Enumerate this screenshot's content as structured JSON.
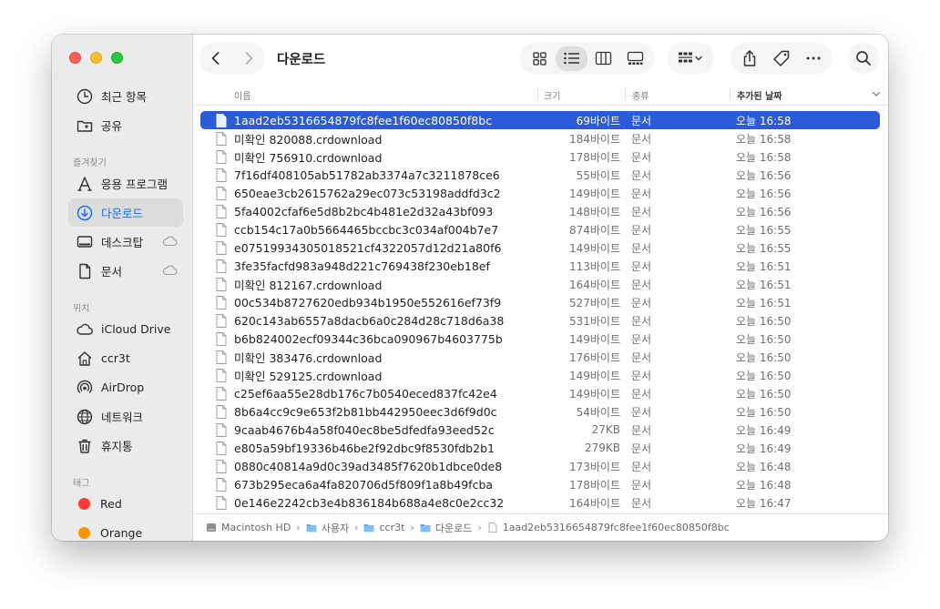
{
  "window": {
    "title": "다운로드"
  },
  "sidebar": {
    "recent": "최근 항목",
    "shared": "공유",
    "favorites_header": "즐겨찾기",
    "favorites": [
      {
        "label": "응용 프로그램",
        "icon": "applications-icon"
      },
      {
        "label": "다운로드",
        "icon": "downloads-icon",
        "active": true
      },
      {
        "label": "데스크탑",
        "icon": "desktop-icon",
        "cloud": true
      },
      {
        "label": "문서",
        "icon": "document-icon",
        "cloud": true
      }
    ],
    "locations_header": "위치",
    "locations": [
      {
        "label": "iCloud Drive",
        "icon": "cloud-icon"
      },
      {
        "label": "ccr3t",
        "icon": "home-icon"
      },
      {
        "label": "AirDrop",
        "icon": "airdrop-icon"
      },
      {
        "label": "네트워크",
        "icon": "globe-icon"
      },
      {
        "label": "휴지통",
        "icon": "trash-icon"
      }
    ],
    "tags_header": "태그",
    "tags": [
      {
        "label": "Red",
        "color": "#fe3b30"
      },
      {
        "label": "Orange",
        "color": "#fd9500"
      }
    ]
  },
  "columns": {
    "name": "이름",
    "size": "크기",
    "kind": "종류",
    "date": "추가된 날짜"
  },
  "files": [
    {
      "name": "1aad2eb5316654879fc8fee1f60ec80850f8bc",
      "size": "69바이트",
      "kind": "문서",
      "date": "오늘 16:58",
      "selected": true
    },
    {
      "name": "미확인 820088.crdownload",
      "size": "184바이트",
      "kind": "문서",
      "date": "오늘 16:58"
    },
    {
      "name": "미확인 756910.crdownload",
      "size": "178바이트",
      "kind": "문서",
      "date": "오늘 16:58"
    },
    {
      "name": "7f16df408105ab51782ab3374a7c3211878ce6",
      "size": "55바이트",
      "kind": "문서",
      "date": "오늘 16:56"
    },
    {
      "name": "650eae3cb2615762a29ec073c53198addfd3c2",
      "size": "149바이트",
      "kind": "문서",
      "date": "오늘 16:56"
    },
    {
      "name": "5fa4002cfaf6e5d8b2bc4b481e2d32a43bf093",
      "size": "148바이트",
      "kind": "문서",
      "date": "오늘 16:56"
    },
    {
      "name": "ccb154c17a0b5664465bccbc3c034af004b7e7",
      "size": "874바이트",
      "kind": "문서",
      "date": "오늘 16:55"
    },
    {
      "name": "e07519934305018521cf4322057d12d21a80f6",
      "size": "149바이트",
      "kind": "문서",
      "date": "오늘 16:55"
    },
    {
      "name": "3fe35facfd983a948d221c769438f230eb18ef",
      "size": "113바이트",
      "kind": "문서",
      "date": "오늘 16:51"
    },
    {
      "name": "미확인 812167.crdownload",
      "size": "164바이트",
      "kind": "문서",
      "date": "오늘 16:51"
    },
    {
      "name": "00c534b8727620edb934b1950e552616ef73f9",
      "size": "527바이트",
      "kind": "문서",
      "date": "오늘 16:51"
    },
    {
      "name": "620c143ab6557a8dacb6a0c284d28c718d6a38",
      "size": "531바이트",
      "kind": "문서",
      "date": "오늘 16:50"
    },
    {
      "name": "b6b824002ecf09344c36bca090967b4603775b",
      "size": "149바이트",
      "kind": "문서",
      "date": "오늘 16:50"
    },
    {
      "name": "미확인 383476.crdownload",
      "size": "176바이트",
      "kind": "문서",
      "date": "오늘 16:50"
    },
    {
      "name": "미확인 529125.crdownload",
      "size": "149바이트",
      "kind": "문서",
      "date": "오늘 16:50"
    },
    {
      "name": "c25ef6aa55e28db176c7b0540eced837fc42e4",
      "size": "149바이트",
      "kind": "문서",
      "date": "오늘 16:50"
    },
    {
      "name": "8b6a4cc9c9e653f2b81bb442950eec3d6f9d0c",
      "size": "54바이트",
      "kind": "문서",
      "date": "오늘 16:50"
    },
    {
      "name": "9caab4676b4a58f040ec8be5dfedfa93eed52c",
      "size": "27KB",
      "kind": "문서",
      "date": "오늘 16:49"
    },
    {
      "name": "e805a59bf19336b46be2f92dbc9f8530fdb2b1",
      "size": "279KB",
      "kind": "문서",
      "date": "오늘 16:49"
    },
    {
      "name": "0880c40814a9d0c39ad3485f7620b1dbce0de8",
      "size": "173바이트",
      "kind": "문서",
      "date": "오늘 16:48"
    },
    {
      "name": "673b295eca6a4fa820706d5f809f1a8b49fcba",
      "size": "178바이트",
      "kind": "문서",
      "date": "오늘 16:48"
    },
    {
      "name": "0e146e2242cb3e4b836184b688a4e8c0e2cc32",
      "size": "164바이트",
      "kind": "문서",
      "date": "오늘 16:47"
    }
  ],
  "pathbar": [
    {
      "label": "Macintosh HD",
      "icon": "disk-icon"
    },
    {
      "label": "사용자",
      "icon": "folder-icon"
    },
    {
      "label": "ccr3t",
      "icon": "folder-icon"
    },
    {
      "label": "다운로드",
      "icon": "folder-icon"
    },
    {
      "label": "1aad2eb5316654879fc8fee1f60ec80850f8bc",
      "icon": "file-icon"
    }
  ],
  "colors": {
    "accent": "#1a6ff0",
    "selection": "#2b5bd9"
  }
}
